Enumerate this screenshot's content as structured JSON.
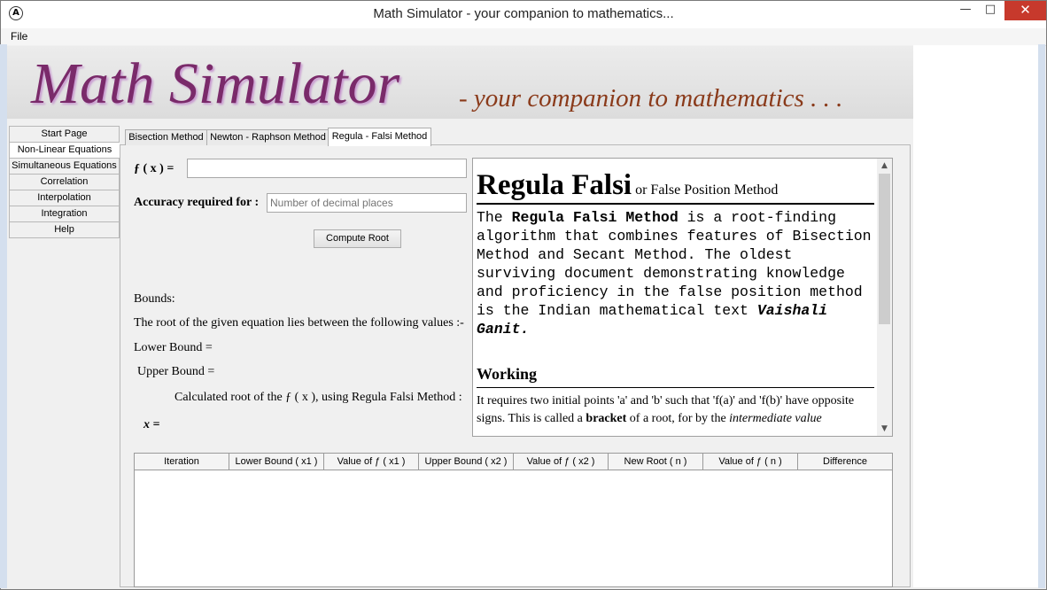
{
  "window": {
    "title": "Math Simulator - your companion to mathematics...",
    "min_icon": "minimize-icon",
    "max_icon": "maximize-icon",
    "close_icon": "close-icon"
  },
  "menubar": {
    "file": "File"
  },
  "banner": {
    "title": "Math Simulator",
    "subtitle": "- your companion to mathematics . . ."
  },
  "sidenav": {
    "items": [
      {
        "label": "Start Page"
      },
      {
        "label": "Non-Linear Equations"
      },
      {
        "label": "Simultaneous Equations"
      },
      {
        "label": "Correlation"
      },
      {
        "label": "Interpolation"
      },
      {
        "label": "Integration"
      },
      {
        "label": "Help"
      }
    ],
    "active": "Non-Linear Equations"
  },
  "tabs": [
    {
      "label": "Bisection Method"
    },
    {
      "label": "Newton - Raphson Method"
    },
    {
      "label": "Regula - Falsi Method"
    }
  ],
  "form": {
    "fx_label": "ƒ ( x )  =",
    "fx_value": "",
    "accuracy_label": "Accuracy required for :",
    "accuracy_placeholder": "Number of decimal places",
    "compute_button": "Compute Root",
    "bounds": "Bounds:",
    "root_lies": "The root of the given equation lies between the following values :-",
    "lower_bound": "Lower Bound  =",
    "upper_bound": "Upper Bound  =",
    "calculated_root": "Calculated root of the ƒ ( x ), using Regula Falsi Method :",
    "x_equals": "x  ="
  },
  "info": {
    "heading_big": "Regula Falsi",
    "heading_small": " or False Position Method",
    "p1_a": "The ",
    "p1_b": "Regula Falsi Method",
    "p1_c": " is a root-finding algorithm that combines features of Bisection Method and Secant Method. The oldest surviving document demonstrating knowledge and proficiency in the false position method is the Indian mathematical text ",
    "p1_d": "Vaishali Ganit.",
    "working": "Working",
    "p2_a": "It requires two initial points 'a' and 'b' such that 'f(a)' and 'f(b)' have opposite signs. This is called a ",
    "p2_b": "bracket",
    "p2_c": " of a root, for by the ",
    "p2_d": "intermediate value"
  },
  "table": {
    "columns": [
      "Iteration",
      "Lower Bound ( x1 )",
      "Value of ƒ ( x1 )",
      "Upper Bound ( x2 )",
      "Value of ƒ ( x2 )",
      "New Root ( n )",
      "Value of ƒ ( n )",
      "Difference"
    ],
    "rows": []
  }
}
